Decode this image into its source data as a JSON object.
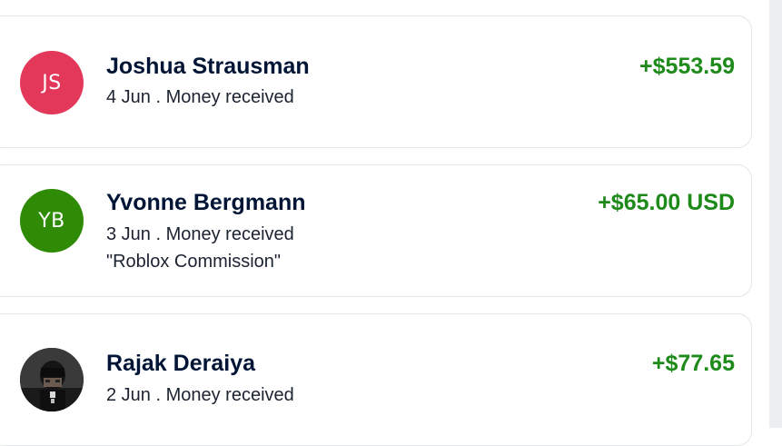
{
  "transactions": [
    {
      "initials": "JS",
      "avatar_color": "#e3385a",
      "name": "Joshua Strausman",
      "meta": "4 Jun . Money received",
      "note": "",
      "amount": "+$553.59"
    },
    {
      "initials": "YB",
      "avatar_color": "#2f8b06",
      "name": "Yvonne Bergmann",
      "meta": "3 Jun . Money received",
      "note": "\"Roblox Commission\"",
      "amount": "+$65.00 USD"
    },
    {
      "initials": "",
      "avatar_color": "#2b2b2b",
      "avatar_icon": "profile-photo",
      "name": "Rajak Deraiya",
      "meta": "2 Jun . Money received",
      "note": "",
      "amount": "+$77.65"
    }
  ],
  "colors": {
    "amount_positive": "#1e8a1a",
    "name_text": "#001435",
    "card_border": "#e3e6ea"
  }
}
